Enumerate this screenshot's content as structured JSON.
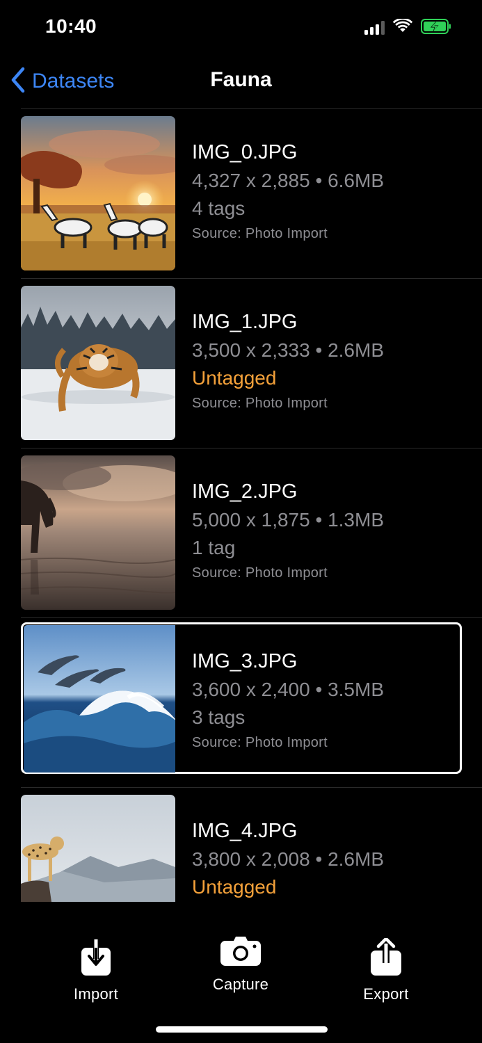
{
  "status_bar": {
    "time": "10:40",
    "icons": [
      "cellular-signal-icon",
      "wifi-icon",
      "battery-charging-icon"
    ],
    "battery_color": "#30d158"
  },
  "nav": {
    "back_label": "Datasets",
    "title": "Fauna",
    "accent_color": "#3d86f5"
  },
  "images": [
    {
      "filename": "IMG_0.JPG",
      "dimensions": "4,327 x 2,885",
      "size": "6.6MB",
      "tags": "4 tags",
      "untagged": false,
      "source": "Source: Photo Import",
      "thumbnail": "zebras at sunset"
    },
    {
      "filename": "IMG_1.JPG",
      "dimensions": "3,500 x 2,333",
      "size": "2.6MB",
      "tags": "Untagged",
      "untagged": true,
      "source": "Source: Photo Import",
      "thumbnail": "tiger in snow"
    },
    {
      "filename": "IMG_2.JPG",
      "dimensions": "5,000 x 1,875",
      "size": "1.3MB",
      "tags": "1 tag",
      "untagged": false,
      "source": "Source: Photo Import",
      "thumbnail": "elephant at water"
    },
    {
      "filename": "IMG_3.JPG",
      "dimensions": "3,600 x 2,400",
      "size": "3.5MB",
      "tags": "3 tags",
      "untagged": false,
      "source": "Source: Photo Import",
      "thumbnail": "dolphins over wave",
      "selected": true
    },
    {
      "filename": "IMG_4.JPG",
      "dimensions": "3,800 x 2,008",
      "size": "2.6MB",
      "tags": "Untagged",
      "untagged": true,
      "source": "",
      "thumbnail": "cheetah on rock"
    }
  ],
  "separator": "•",
  "untagged_color": "#f4a13a",
  "toolbar": {
    "import_label": "Import",
    "capture_label": "Capture",
    "export_label": "Export"
  }
}
